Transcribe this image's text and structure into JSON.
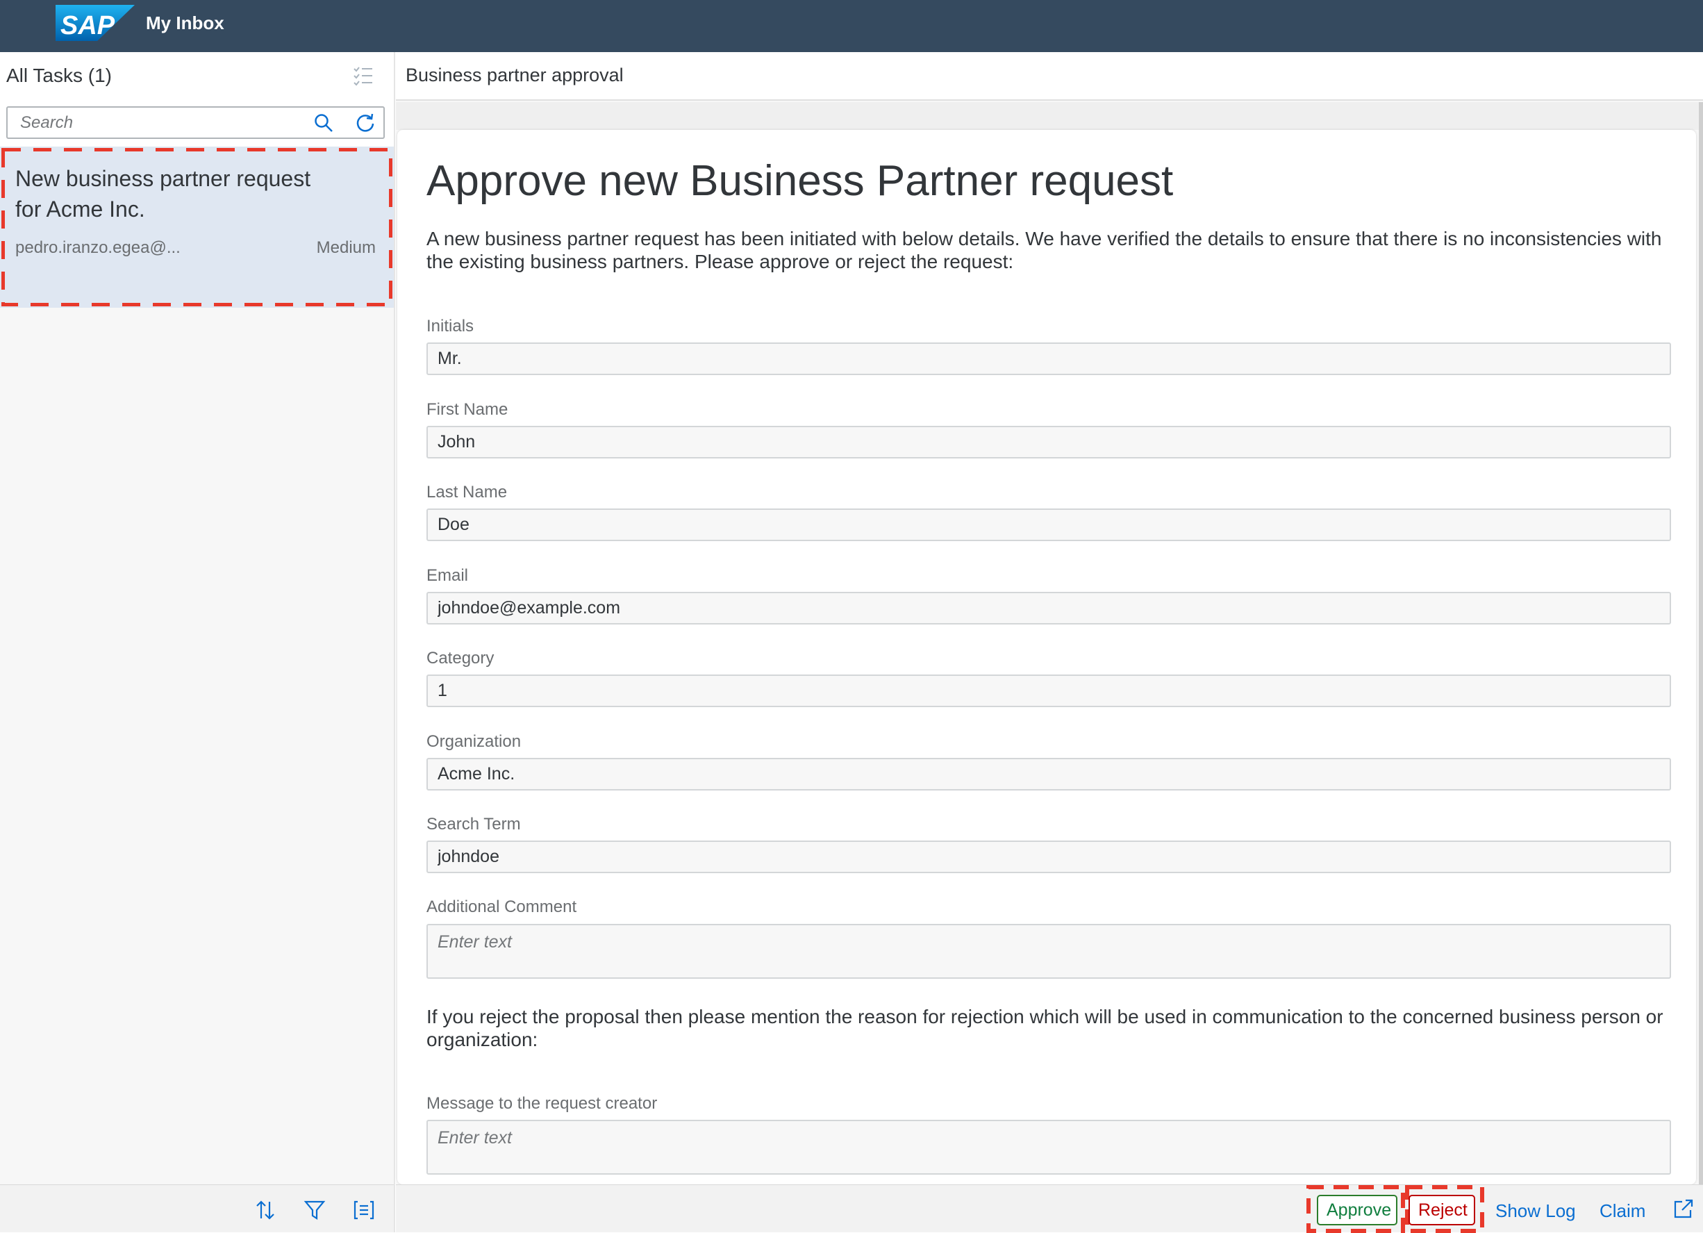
{
  "shell": {
    "logo_text": "SAP",
    "app_title": "My Inbox",
    "color": "#354a5f"
  },
  "master": {
    "title": "All Tasks (1)",
    "search_placeholder": "Search",
    "icons": [
      "multi-select-icon",
      "search-icon",
      "refresh-icon",
      "sort-icon",
      "filter-icon",
      "group-icon"
    ],
    "tasks": [
      {
        "title": "New business partner request for Acme Inc.",
        "creator": "pedro.iranzo.egea@...",
        "priority": "Medium",
        "selected": true
      }
    ]
  },
  "detail": {
    "header_title": "Business partner approval",
    "heading": "Approve new Business Partner request",
    "intro": "A new business partner request has been initiated with below details. We have verified the details to ensure that there is no inconsistencies with the existing business partners. Please approve or reject the request:",
    "fields": [
      {
        "label": "Initials",
        "value": "Mr."
      },
      {
        "label": "First Name",
        "value": "John"
      },
      {
        "label": "Last Name",
        "value": "Doe"
      },
      {
        "label": "Email",
        "value": "johndoe@example.com"
      },
      {
        "label": "Category",
        "value": "1"
      },
      {
        "label": "Organization",
        "value": "Acme Inc."
      },
      {
        "label": "Search Term",
        "value": "johndoe"
      }
    ],
    "additional_comment": {
      "label": "Additional Comment",
      "placeholder": "Enter text"
    },
    "reject_note": "If you reject the proposal then please mention the reason for rejection which will be used in communication to the concerned business person or organization:",
    "message": {
      "label": "Message to the request creator",
      "placeholder": "Enter text"
    }
  },
  "footer": {
    "approve_label": "Approve",
    "reject_label": "Reject",
    "show_log_label": "Show Log",
    "claim_label": "Claim",
    "approve_color": "#107e3e",
    "reject_color": "#bb0000",
    "link_color": "#0a6ed1"
  },
  "highlight_color": "#e8392b"
}
